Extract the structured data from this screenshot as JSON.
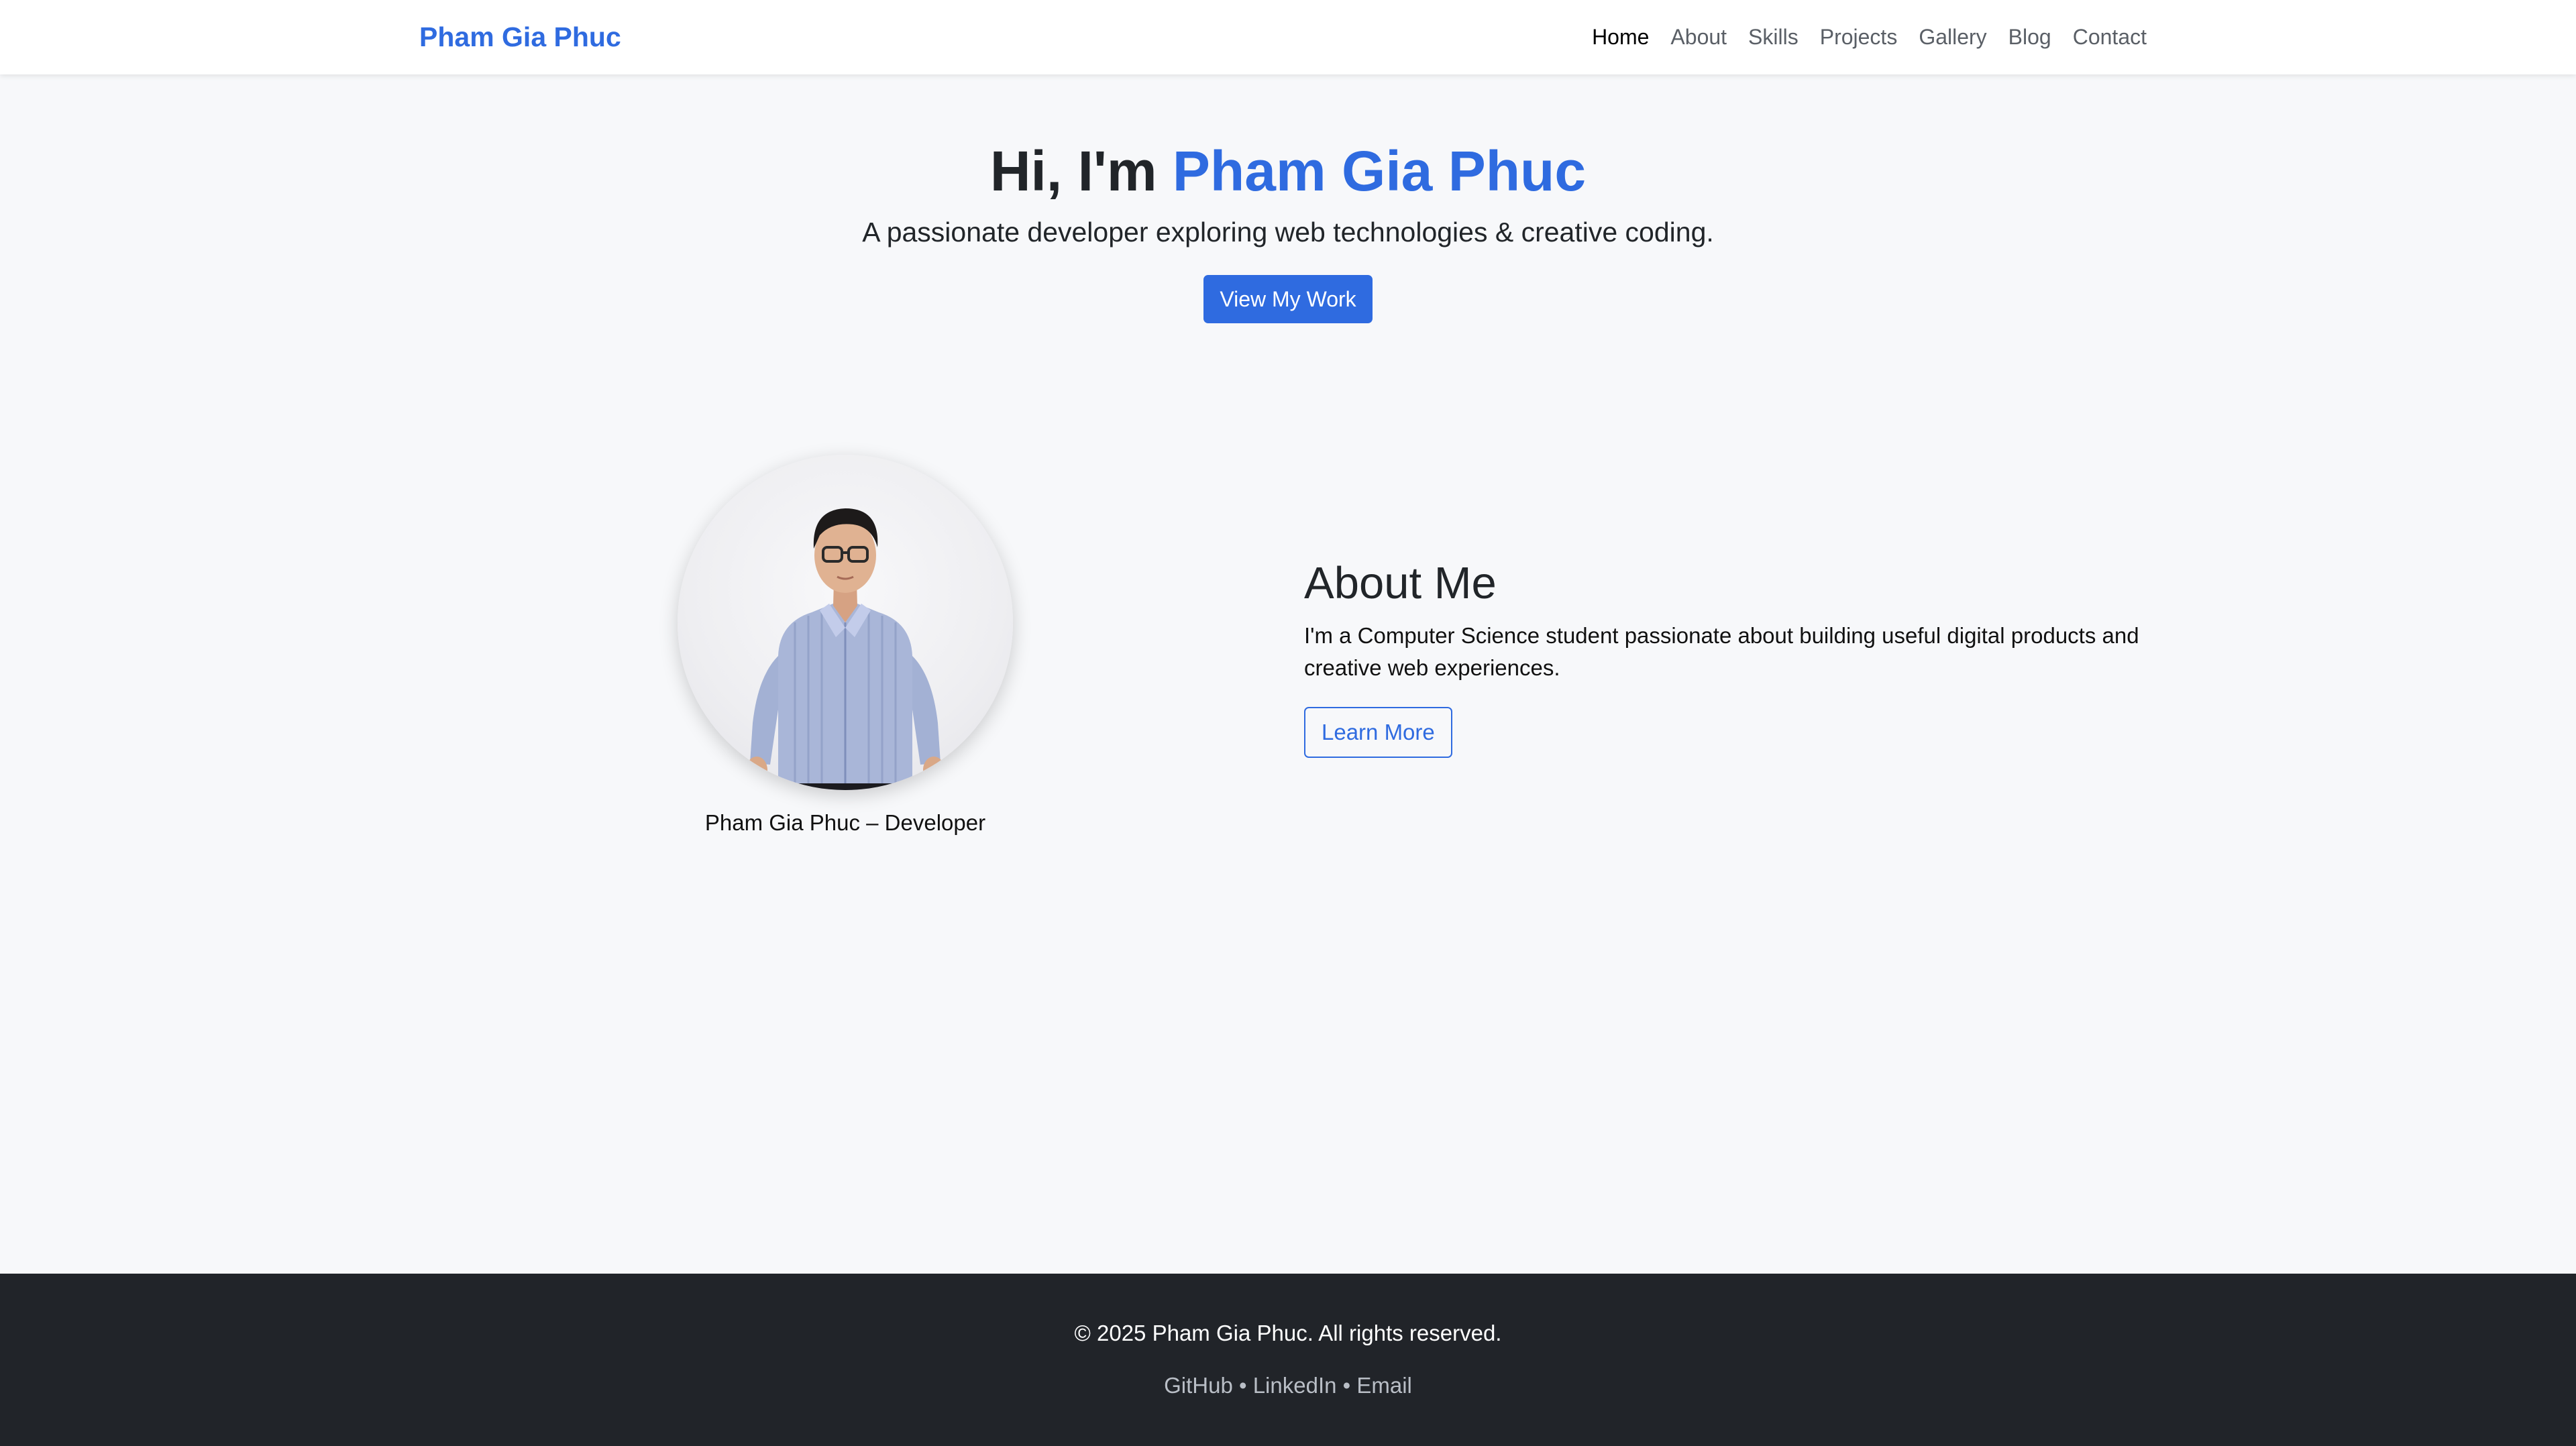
{
  "navbar": {
    "brand": "Pham Gia Phuc",
    "links": [
      {
        "label": "Home",
        "active": true
      },
      {
        "label": "About"
      },
      {
        "label": "Skills"
      },
      {
        "label": "Projects"
      },
      {
        "label": "Gallery"
      },
      {
        "label": "Blog"
      },
      {
        "label": "Contact"
      }
    ]
  },
  "hero": {
    "greeting": "Hi, I'm ",
    "name": "Pham Gia Phuc",
    "subtitle": "A passionate developer exploring web technologies & creative coding.",
    "cta_label": "View My Work"
  },
  "about": {
    "caption": "Pham Gia Phuc – Developer",
    "title": "About Me",
    "text": "I'm a Computer Science student passionate about building useful digital products and creative web experiences.",
    "button_label": "Learn More"
  },
  "footer": {
    "copyright": "© 2025 Pham Gia Phuc. All rights reserved.",
    "links": [
      "GitHub",
      "LinkedIn",
      "Email"
    ],
    "separator": " • "
  },
  "colors": {
    "accent": "#2f6be0",
    "page_bg": "#f7f8fa",
    "footer_bg": "#212429",
    "text": "#212529"
  }
}
